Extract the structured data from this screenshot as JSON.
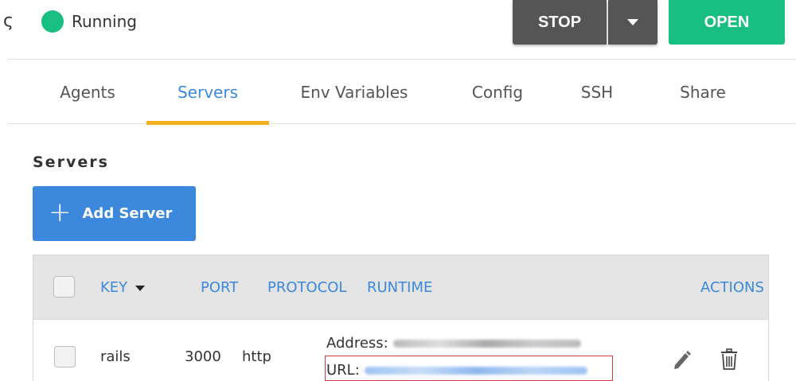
{
  "header": {
    "title_fragment": "ς",
    "status": {
      "text": "Running",
      "color": "#19be83"
    },
    "stop_label": "STOP",
    "open_label": "OPEN"
  },
  "tabs": [
    {
      "label": "Agents",
      "active": false
    },
    {
      "label": "Servers",
      "active": true
    },
    {
      "label": "Env Variables",
      "active": false
    },
    {
      "label": "Config",
      "active": false
    },
    {
      "label": "SSH",
      "active": false
    },
    {
      "label": "Share",
      "active": false
    }
  ],
  "section": {
    "title": "Servers",
    "add_label": "Add Server"
  },
  "table": {
    "headers": {
      "key": "KEY",
      "port": "PORT",
      "protocol": "PROTOCOL",
      "runtime": "RUNTIME",
      "actions": "ACTIONS"
    },
    "rows": [
      {
        "key": "rails",
        "port": "3000",
        "protocol": "http",
        "address_label": "Address:",
        "url_label": "URL:"
      }
    ]
  },
  "icons": {
    "plus": "plus-icon",
    "caret": "caret-down-icon",
    "edit": "pencil-icon",
    "delete": "trash-icon"
  },
  "colors": {
    "accent": "#3b88dc",
    "success": "#19be83",
    "tab_underline": "#f0b020",
    "dark_button": "#555555"
  }
}
